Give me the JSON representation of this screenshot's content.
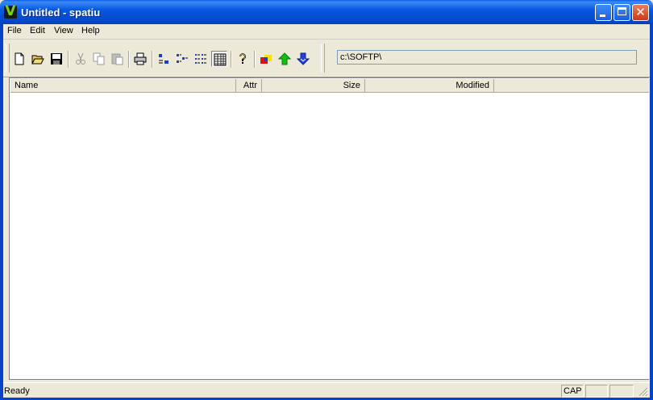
{
  "window": {
    "title": "Untitled - spatiu",
    "icon": "app-v-icon",
    "controls": [
      "minimize-icon",
      "maximize-icon",
      "close-icon"
    ],
    "close_glyph": "✕"
  },
  "menu": {
    "items": [
      "File",
      "Edit",
      "View",
      "Help"
    ]
  },
  "toolbar": {
    "buttons": [
      "new-file-icon",
      "open-folder-icon",
      "save-icon",
      "cut-icon",
      "copy-icon",
      "paste-icon",
      "print-icon",
      "view-large-icons-icon",
      "view-small-icons-icon",
      "view-list-icon",
      "view-details-icon",
      "help-icon",
      "colors-icon",
      "up-arrow-icon",
      "down-arrow-icon"
    ],
    "path_value": "c:\\SOFTP\\"
  },
  "file_list": {
    "columns": [
      "Name",
      "Attr",
      "Size",
      "Modified"
    ],
    "rows": []
  },
  "status": {
    "text": "Ready",
    "caps": "CAP",
    "num": "",
    "scrl": ""
  }
}
